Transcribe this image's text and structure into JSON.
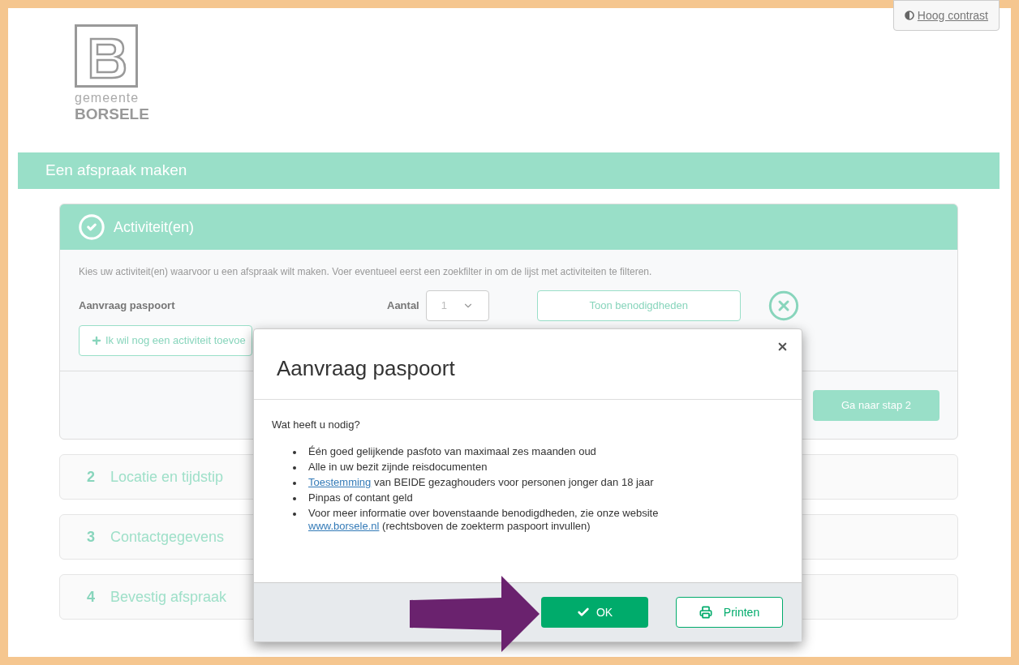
{
  "header": {
    "contrast_link": "Hoog contrast",
    "logo": {
      "top": "gemeente",
      "bottom": "BORSELE"
    }
  },
  "title_bar": "Een afspraak maken",
  "steps": [
    {
      "label": "Activiteit(en)",
      "completed": true,
      "expanded": true
    },
    {
      "number": "2",
      "label": "Locatie en tijdstip",
      "completed": false,
      "expanded": false
    },
    {
      "number": "3",
      "label": "Contactgegevens",
      "completed": false,
      "expanded": false
    },
    {
      "number": "4",
      "label": "Bevestig afspraak",
      "completed": false,
      "expanded": false
    }
  ],
  "activities": {
    "description": "Kies uw activiteit(en) waarvoor u een afspraak wilt maken. Voer eventueel eerst een zoekfilter in om de lijst met activiteiten te filteren.",
    "rows": [
      {
        "name": "Aanvraag paspoort",
        "count_label": "Aantal",
        "count": "1",
        "details_button": "Toon benodigdheden"
      }
    ],
    "add_button": "Ik wil nog een activiteit toevoe",
    "next_button": "Ga naar stap 2"
  },
  "modal": {
    "title": "Aanvraag paspoort",
    "intro": "Wat heeft u nodig?",
    "items": [
      [
        {
          "kind": "text",
          "text": "Één goed gelijkende pasfoto van maximaal zes maanden oud"
        }
      ],
      [
        {
          "kind": "text",
          "text": "Alle in uw bezit zijnde reisdocumenten"
        }
      ],
      [
        {
          "kind": "link",
          "text": "Toestemming"
        },
        {
          "kind": "text",
          "text": " van BEIDE gezaghouders voor personen jonger dan 18 jaar"
        }
      ],
      [
        {
          "kind": "text",
          "text": "Pinpas of contant geld"
        }
      ],
      [
        {
          "kind": "text",
          "text": "Voor meer informatie over bovenstaande benodigdheden, zie onze website "
        },
        {
          "kind": "link",
          "text": "www.borsele.nl"
        },
        {
          "kind": "text",
          "text": " (rechtsboven de zoekterm paspoort invullen)"
        }
      ]
    ],
    "buttons": [
      {
        "kind": "primary",
        "label": "OK"
      },
      {
        "kind": "print",
        "label": "Printen"
      }
    ]
  }
}
